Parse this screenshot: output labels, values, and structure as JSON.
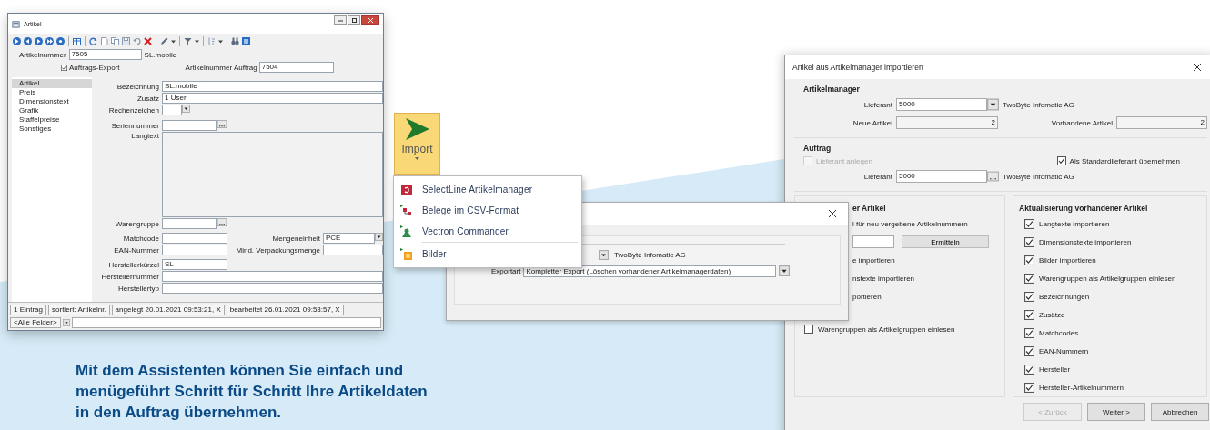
{
  "article_window": {
    "title": "Artikel",
    "number_label": "Artikelnummer",
    "number": "7505",
    "name": "SL.mobile",
    "export_checkbox": {
      "label": "Auftrags-Export",
      "checked": true
    },
    "order_number_label": "Artikelnummer Auftrag",
    "order_number": "7504",
    "sidebar": [
      {
        "label": "Artikel",
        "selected": true
      },
      {
        "label": "Preis",
        "selected": false
      },
      {
        "label": "Dimensionstext",
        "selected": false
      },
      {
        "label": "Grafik",
        "selected": false
      },
      {
        "label": "Staffelpreise",
        "selected": false
      },
      {
        "label": "Sonstiges",
        "selected": false
      }
    ],
    "rows": [
      [
        {
          "kind": "text",
          "label": "Bezeichnung",
          "value": "SL.mobile"
        }
      ],
      [
        {
          "kind": "text",
          "label": "Zusatz",
          "value": "1 User"
        }
      ],
      [
        {
          "kind": "combo",
          "label": "Rechenzeichen"
        }
      ],
      [
        {
          "kind": "lookup",
          "label": "Seriennummer"
        }
      ],
      [
        {
          "kind": "memo",
          "label": "Langtext"
        }
      ],
      [
        {
          "kind": "lookup",
          "label": "Warengruppe"
        }
      ],
      [
        {
          "kind": "short",
          "label": "Matchcode"
        },
        {
          "kind": "combo_wide",
          "label": "Mengeneinheit",
          "value": "PCE"
        }
      ],
      [
        {
          "kind": "short",
          "label": "EAN-Nummer"
        },
        {
          "kind": "short",
          "label": "Mind. Verpackungsmenge"
        }
      ],
      [
        {
          "kind": "short",
          "label": "Herstellerkürzel",
          "value": "SL"
        }
      ],
      [
        {
          "kind": "text",
          "label": "Herstellernummer"
        }
      ],
      [
        {
          "kind": "text",
          "label": "Herstellertyp"
        }
      ]
    ],
    "status_bar": [
      "1 Eintrag",
      "sortiert: Artikelnr.",
      "angelegt 20.01.2021 09:53:21, X",
      "bearbeitet 26.01.2021 09:53:57, X"
    ],
    "status_filter": "<Alle Felder>"
  },
  "import_button": {
    "label": "Import"
  },
  "import_menu": [
    {
      "kind": "manager",
      "label": "SelectLine Artikelmanager",
      "separator_before": false
    },
    {
      "kind": "csv",
      "label": "Belege im CSV-Format",
      "separator_before": false
    },
    {
      "kind": "vectron",
      "label": "Vectron Commander",
      "separator_before": false
    },
    {
      "kind": "images",
      "label": "Bilder",
      "separator_before": true
    }
  ],
  "export_dialog": {
    "supplier_name": "TwoByte Infomatic AG",
    "export_type_label": "Exportart",
    "export_type": "Kompletter Export (Löschen vorhandener Artikelmanagerdaten)"
  },
  "import_dialog": {
    "title": "Artikel aus Artikelmanager importieren",
    "manager_group": {
      "title": "Artikelmanager",
      "supplier_label": "Lieferant",
      "supplier": "5000",
      "supplier_name": "TwoByte Infomatic AG",
      "new_label": "Neue Artikel",
      "new_count": "2",
      "existing_label": "Vorhandene Artikel",
      "existing_count": "2"
    },
    "order_group": {
      "title": "Auftrag",
      "create_supplier": {
        "label": "Lieferant anlegen",
        "checked": false,
        "disabled": true
      },
      "default_supplier": {
        "label": "Als Standardlieferant übernehmen",
        "checked": true
      },
      "supplier_label": "Lieferant",
      "supplier": "5000",
      "supplier_name": "TwoByte Infomatic AG"
    },
    "new_group": {
      "title": "er Artikel",
      "items": [
        {
          "kind": "text",
          "label": "l für neu vergebene Artikelnummern"
        },
        {
          "kind": "input_button",
          "label": "Ermitteln"
        },
        {
          "kind": "text",
          "label": "e importieren"
        },
        {
          "kind": "text",
          "label": "nstexte importieren"
        },
        {
          "kind": "text",
          "label": "portieren"
        },
        {
          "kind": "checkbox",
          "label": "Warengruppen als Artikelgruppen einlesen",
          "checked": false
        }
      ]
    },
    "update_group": {
      "title": "Aktualisierung vorhandener Artikel",
      "options": [
        {
          "label": "Langtexte importieren",
          "checked": true
        },
        {
          "label": "Dimensionstexte importieren",
          "checked": true
        },
        {
          "label": "Bilder importieren",
          "checked": true
        },
        {
          "label": "Warengruppen als Artikelgruppen einlesen",
          "checked": true
        },
        {
          "label": "Bezeichnungen",
          "checked": true
        },
        {
          "label": "Zusätze",
          "checked": true
        },
        {
          "label": "Matchcodes",
          "checked": true
        },
        {
          "label": "EAN-Nummern",
          "checked": true
        },
        {
          "label": "Hersteller",
          "checked": true
        },
        {
          "label": "Hersteller-Artikelnummern",
          "checked": true
        }
      ]
    },
    "buttons": [
      {
        "label": "< Zurück",
        "disabled": true
      },
      {
        "label": "Weiter >",
        "disabled": false
      },
      {
        "label": "Abbrechen",
        "disabled": false
      }
    ]
  },
  "caption": "Mit dem Assistenten können Sie einfach und menügeführt Schritt für Schritt Ihre Artikeldaten in den Auftrag übernehmen."
}
